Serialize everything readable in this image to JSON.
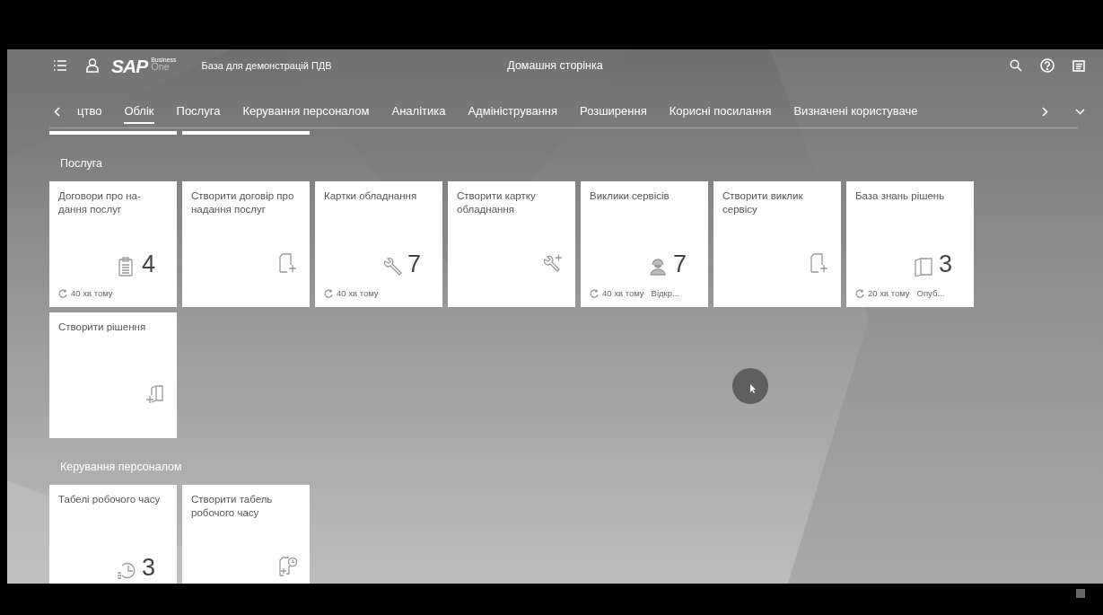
{
  "shell": {
    "logo_mark": "SAP",
    "logo_line1": "Business",
    "logo_line2": "One",
    "company": "База для демонстрацій ПДВ",
    "title": "Домашня сторінка"
  },
  "tabs": [
    {
      "label": "цтво",
      "selected": false
    },
    {
      "label": "Облік",
      "selected": true
    },
    {
      "label": "Послуга",
      "selected": false
    },
    {
      "label": "Керування персоналом",
      "selected": false
    },
    {
      "label": "Аналітика",
      "selected": false
    },
    {
      "label": "Адміністрування",
      "selected": false
    },
    {
      "label": "Розширення",
      "selected": false
    },
    {
      "label": "Корисні посилання",
      "selected": false
    },
    {
      "label": "Визначені користуваче",
      "selected": false
    }
  ],
  "groups": [
    {
      "title": "Послуга",
      "tiles": [
        {
          "kind": "count",
          "title": "Договори про на-дання послуг",
          "count": "4",
          "updated": "40 хв тому"
        },
        {
          "kind": "create",
          "title": "Створити договір про надання послуг"
        },
        {
          "kind": "count",
          "title": "Картки обладнання",
          "count": "7",
          "updated": "40 хв тому"
        },
        {
          "kind": "create",
          "title": "Створити картку обладнання"
        },
        {
          "kind": "count",
          "title": "Виклики сервісів",
          "count": "7",
          "updated": "40 хв тому",
          "status": "Відкр..."
        },
        {
          "kind": "create",
          "title": "Створити виклик сервісу"
        },
        {
          "kind": "count",
          "title": "База знань рішень",
          "count": "3",
          "updated": "20 хв тому",
          "status": "Опуб..."
        },
        {
          "kind": "create",
          "title": "Створити рішення"
        }
      ]
    },
    {
      "title": "Керування персоналом",
      "tiles": [
        {
          "kind": "count",
          "title": "Табелі робочого часу",
          "count": "3"
        },
        {
          "kind": "create",
          "title": "Створити табель робочого часу"
        }
      ]
    }
  ]
}
